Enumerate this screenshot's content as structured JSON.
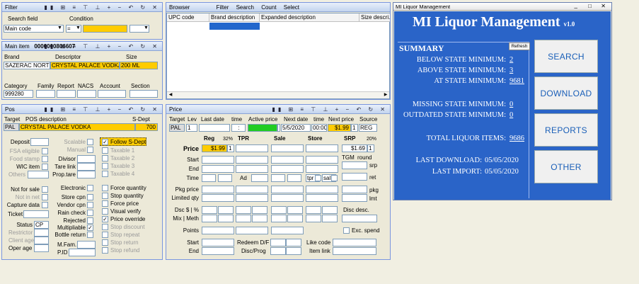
{
  "filter": {
    "title": "Filter",
    "col_search_field": "Search field",
    "col_condition": "Condition",
    "field_value": "Main code",
    "condition_value": "="
  },
  "browser": {
    "title": "Browser",
    "menu": [
      "Filter",
      "Search",
      "Count",
      "Select"
    ],
    "columns": [
      "UPC code",
      "Brand description",
      "Expanded description",
      "Size descri..."
    ]
  },
  "main_item": {
    "title": "Main item",
    "code": "0000000806607",
    "label_brand": "Brand",
    "label_descriptor": "Descriptor",
    "label_size": "Size",
    "brand": "SAZERAC NORTH",
    "descriptor": "CRYSTAL PALACE VODKA",
    "size": "200 ML",
    "label_category": "Category",
    "label_family": "Family",
    "label_report": "Report",
    "label_nacs": "NACS",
    "label_account": "Account",
    "label_section": "Section",
    "category": "999280"
  },
  "pos": {
    "title": "Pos",
    "label_target": "Target",
    "label_pos_desc": "POS description",
    "label_sdept": "S-Dept",
    "target": "PAL",
    "description": "CRYSTAL PALACE VODKA",
    "sdept": "700",
    "label_deposit": "Deposit",
    "fsa": "FSA eligible",
    "food_stamp": "Food stamp",
    "wic": "WIC item",
    "others": "Others",
    "scalable": "Scalable",
    "manual": "Manual",
    "divisor": "Divisor",
    "tare_link": "Tare link",
    "prop_tare": "Prop.tare",
    "follow": "Follow S-Dept",
    "taxables": [
      "Taxable 1",
      "Taxable 2",
      "Taxable 3",
      "Taxable 4"
    ],
    "not_for_sale": "Not for sale",
    "not_in_net": "Not in net",
    "capture_data": "Capture data",
    "ticket": "Ticket",
    "status": "Status",
    "status_value": "CP",
    "restrictor": "Restrictor",
    "client_age": "Client age",
    "oper_age": "Oper age",
    "electronic": "Electronic",
    "store_cpn": "Store cpn",
    "vendor_cpn": "Vendor cpn",
    "rain_check": "Rain check",
    "rejected": "Rejected",
    "multipliable": "Multipliable",
    "bottle_return": "Bottle return",
    "mfam": "M.Fam.",
    "pid": "P.ID",
    "flags": [
      "Force quantity",
      "Stop quantity",
      "Force price",
      "Visual verify",
      "Price override",
      "Stop discount",
      "Stop repeat",
      "Stop return",
      "Stop refund"
    ]
  },
  "price": {
    "title": "Price",
    "headers": [
      "Target",
      "Lev",
      "Last date",
      "time",
      "Active price",
      "Next date",
      "time",
      "Next price",
      "Source"
    ],
    "target": "PAL",
    "lev": "1",
    "time1": ":",
    "next_date": "5/5/2020",
    "next_time": "00:00",
    "next_price": "$1.99",
    "next_lev": "1",
    "source": "REG",
    "col_reg": "Reg",
    "reg_pct": "32%",
    "col_tpr": "TPR",
    "col_sale": "Sale",
    "col_store": "Store",
    "col_srp": "SRP",
    "srp_pct": "20%",
    "row_price": "Price",
    "reg_price": "$1.99",
    "reg_lev": "1",
    "srp_price": "$1.69",
    "srp_lev": "1",
    "tgm": "TGM",
    "round": "round",
    "srp": "srp",
    "ret": "ret",
    "row_start": "Start",
    "row_end": "End",
    "row_time": "Time",
    "ad": "Ad",
    "tpr_lbl": "tpr",
    "sal_lbl": "sal",
    "pkg_price": "Pkg price",
    "limited_qty": "Limited qty",
    "pkg": "pkg",
    "lmt": "lmt",
    "dsc": "Dsc $ | %",
    "mix_meth": "Mix | Meth",
    "disc_desc": "Disc desc.",
    "points": "Points",
    "exc_spend": "Exc. spend",
    "start2": "Start",
    "end2": "End",
    "redeem": "Redeem D/F",
    "disc_prog": "Disc/Prog",
    "like_code": "Like code",
    "item_link": "Item link"
  },
  "mi": {
    "window_title": "MI Liquor Management",
    "heading": "MI Liquor Management",
    "version": "v1.0",
    "summary": "SUMMARY",
    "refresh": "Refresh",
    "below_label": "BELOW STATE MINIMUM:",
    "below_value": "2",
    "above_label": "ABOVE STATE MINIMUM:",
    "above_value": "3",
    "at_label": "AT STATE MINIMUM:",
    "at_value": "9681",
    "missing_label": "MISSING STATE MINIMUM:",
    "missing_value": "0",
    "outdated_label": "OUTDATED STATE MINIMUM:",
    "outdated_value": "0",
    "total_label": "TOTAL LIQUOR ITEMS:",
    "total_value": "9686",
    "last_download_label": "LAST DOWNLOAD:",
    "last_download_value": "05/05/2020",
    "last_import_label": "LAST IMPORT:",
    "last_import_value": "05/05/2020",
    "buttons": [
      "SEARCH",
      "DOWNLOAD",
      "REPORTS",
      "OTHER"
    ],
    "win_controls": [
      "_",
      "□",
      "✕"
    ]
  },
  "toolbar_glyphs": "▮▮ ⊞ ≡ ⊤ ⊥ + − ↶ ↻ ✕",
  "colors": {
    "accent_yellow": "#ffcc00",
    "active_green": "#22cc22",
    "mi_blue": "#2a64c8"
  }
}
